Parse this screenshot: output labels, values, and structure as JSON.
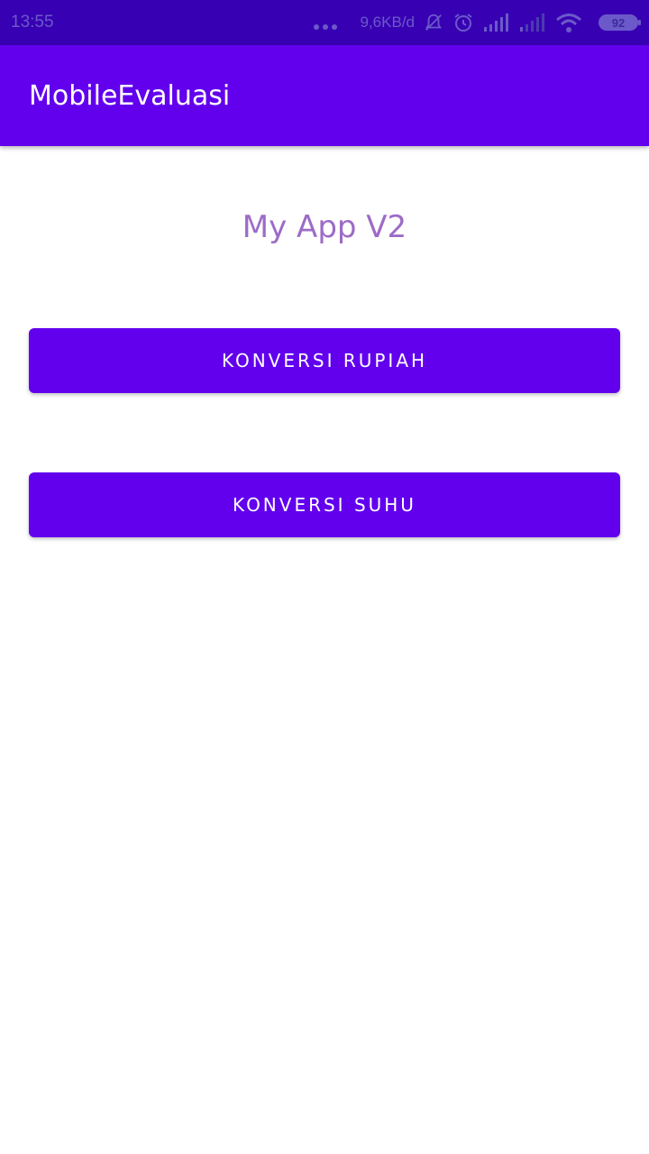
{
  "status_bar": {
    "time": "13:55",
    "net_speed": "9,6KB/d",
    "battery": "92",
    "icons": [
      "more-dots-icon",
      "notifications-off-icon",
      "alarm-icon",
      "signal-icon",
      "signal-weak-icon",
      "wifi-icon",
      "battery-icon"
    ],
    "bg_color": "#3700b3"
  },
  "app_bar": {
    "title": "MobileEvaluasi",
    "bg_color": "#6200ee"
  },
  "main": {
    "heading": "My App V2",
    "heading_color": "#9c6bc7",
    "buttons": [
      {
        "label": "KONVERSI RUPIAH"
      },
      {
        "label": "KONVERSI SUHU"
      }
    ]
  }
}
